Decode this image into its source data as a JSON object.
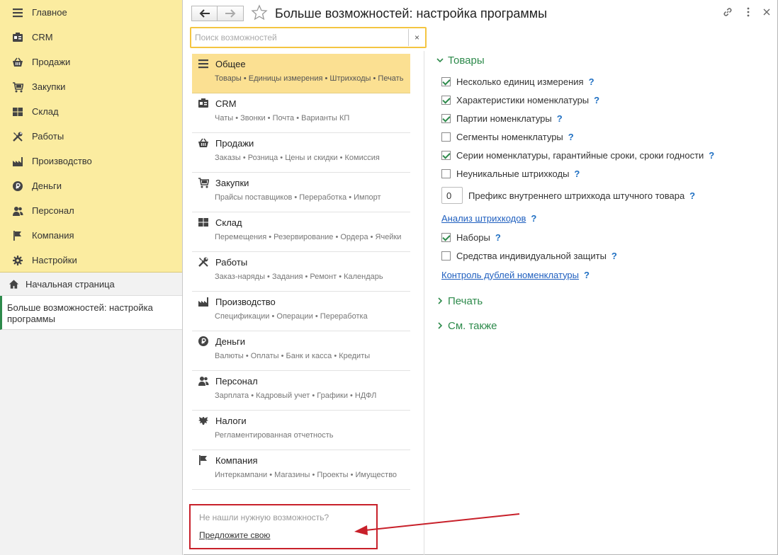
{
  "sections": [
    {
      "label": "Главное",
      "icon": "menu-icon"
    },
    {
      "label": "CRM",
      "icon": "crm-icon"
    },
    {
      "label": "Продажи",
      "icon": "basket-icon"
    },
    {
      "label": "Закупки",
      "icon": "cart-icon"
    },
    {
      "label": "Склад",
      "icon": "warehouse-icon"
    },
    {
      "label": "Работы",
      "icon": "tools-icon"
    },
    {
      "label": "Производство",
      "icon": "factory-icon"
    },
    {
      "label": "Деньги",
      "icon": "ruble-icon"
    },
    {
      "label": "Персонал",
      "icon": "people-icon"
    },
    {
      "label": "Компания",
      "icon": "flag-icon"
    },
    {
      "label": "Настройки",
      "icon": "gear-icon"
    }
  ],
  "home": {
    "label": "Начальная страница"
  },
  "open_window": {
    "label": "Больше возможностей: настройка программы"
  },
  "header": {
    "title": "Больше возможностей: настройка программы"
  },
  "search": {
    "placeholder": "Поиск возможностей",
    "value": "",
    "clear": "×"
  },
  "categories": [
    {
      "name": "Общее",
      "sub": "Товары • Единицы измерения • Штрихкоды • Печать",
      "icon": "menu-icon",
      "selected": true
    },
    {
      "name": "CRM",
      "sub": "Чаты • Звонки • Почта • Варианты КП",
      "icon": "crm-icon"
    },
    {
      "name": "Продажи",
      "sub": "Заказы • Розница • Цены и скидки • Комиссия",
      "icon": "basket-icon"
    },
    {
      "name": "Закупки",
      "sub": "Прайсы поставщиков • Переработка • Импорт",
      "icon": "cart-icon"
    },
    {
      "name": "Склад",
      "sub": "Перемещения • Резервирование • Ордера • Ячейки",
      "icon": "warehouse-icon"
    },
    {
      "name": "Работы",
      "sub": "Заказ-наряды • Задания • Ремонт • Календарь",
      "icon": "tools-icon"
    },
    {
      "name": "Производство",
      "sub": "Спецификации • Операции • Переработка",
      "icon": "factory-icon"
    },
    {
      "name": "Деньги",
      "sub": "Валюты • Оплаты • Банк и касса • Кредиты",
      "icon": "ruble-icon"
    },
    {
      "name": "Персонал",
      "sub": "Зарплата • Кадровый учет • Графики • НДФЛ",
      "icon": "people-icon"
    },
    {
      "name": "Налоги",
      "sub": "Регламентированная отчетность",
      "icon": "eagle-icon"
    },
    {
      "name": "Компания",
      "sub": "Интеркампани • Магазины • Проекты • Имущество",
      "icon": "flag-icon"
    }
  ],
  "suggest": {
    "question": "Не нашли нужную возможность?",
    "link": "Предложите свою"
  },
  "settings": {
    "group_goods": "Товары",
    "options": [
      {
        "label": "Несколько единиц измерения",
        "checked": true
      },
      {
        "label": "Характеристики номенклатуры",
        "checked": true
      },
      {
        "label": "Партии номенклатуры",
        "checked": true
      },
      {
        "label": "Сегменты номенклатуры",
        "checked": false
      },
      {
        "label": "Серии номенклатуры, гарантийные сроки, сроки годности",
        "checked": true
      },
      {
        "label": "Неуникальные штрихкоды",
        "checked": false
      }
    ],
    "prefix_value": "0",
    "prefix_label": "Префикс внутреннего штрихкода штучного товара",
    "barcode_link": "Анализ штрихкодов",
    "kits_label": "Наборы",
    "ppe_label": "Средства индивидуальной защиты",
    "dup_link": "Контроль дублей номенклатуры",
    "group_print": "Печать",
    "group_see_also": "См. также",
    "help_mark": "?"
  },
  "colors": {
    "accent_green": "#2d8a4b",
    "nav_yellow": "#fbeca0",
    "selected_yellow": "#fbe092",
    "annotation_red": "#c8202a",
    "link_blue": "#1f5fbf"
  }
}
